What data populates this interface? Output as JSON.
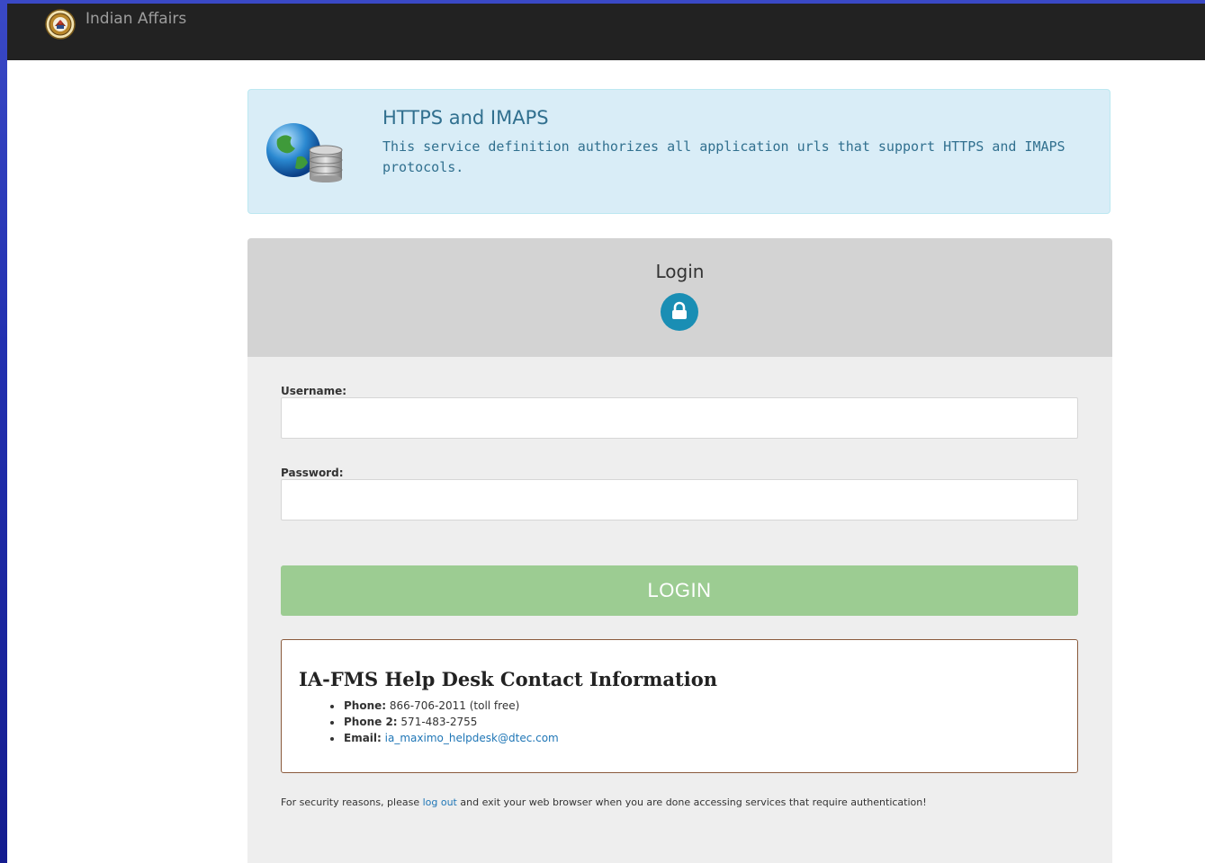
{
  "nav": {
    "logo_icon": "indian-affairs-seal-icon",
    "brand": "Indian Affairs"
  },
  "notice": {
    "icon": "globe-database-icon",
    "title": "HTTPS and IMAPS",
    "description": "This service definition authorizes all application urls that support HTTPS and IMAPS protocols."
  },
  "login": {
    "title": "Login",
    "lock_icon": "lock-icon",
    "username_label": "Username:",
    "username_value": "",
    "password_label": "Password:",
    "password_value": "",
    "submit_label": "LOGIN"
  },
  "helpdesk": {
    "title": "IA-FMS Help Desk Contact Information",
    "items": [
      {
        "label": "Phone:",
        "value": "866-706-2011 (toll free)"
      },
      {
        "label": "Phone 2:",
        "value": "571-483-2755"
      },
      {
        "label": "Email:",
        "value": "ia_maximo_helpdesk@dtec.com"
      }
    ]
  },
  "security": {
    "before": "For security reasons, please ",
    "link": "log out",
    "after": " and exit your web browser when you are done accessing services that require authentication!"
  },
  "colors": {
    "navbar": "#222222",
    "notice_bg": "#d9edf7",
    "notice_text": "#31708f",
    "login_button": "#9ccc92",
    "lock_circle": "#1a8eb4",
    "link": "#1f76b6"
  }
}
